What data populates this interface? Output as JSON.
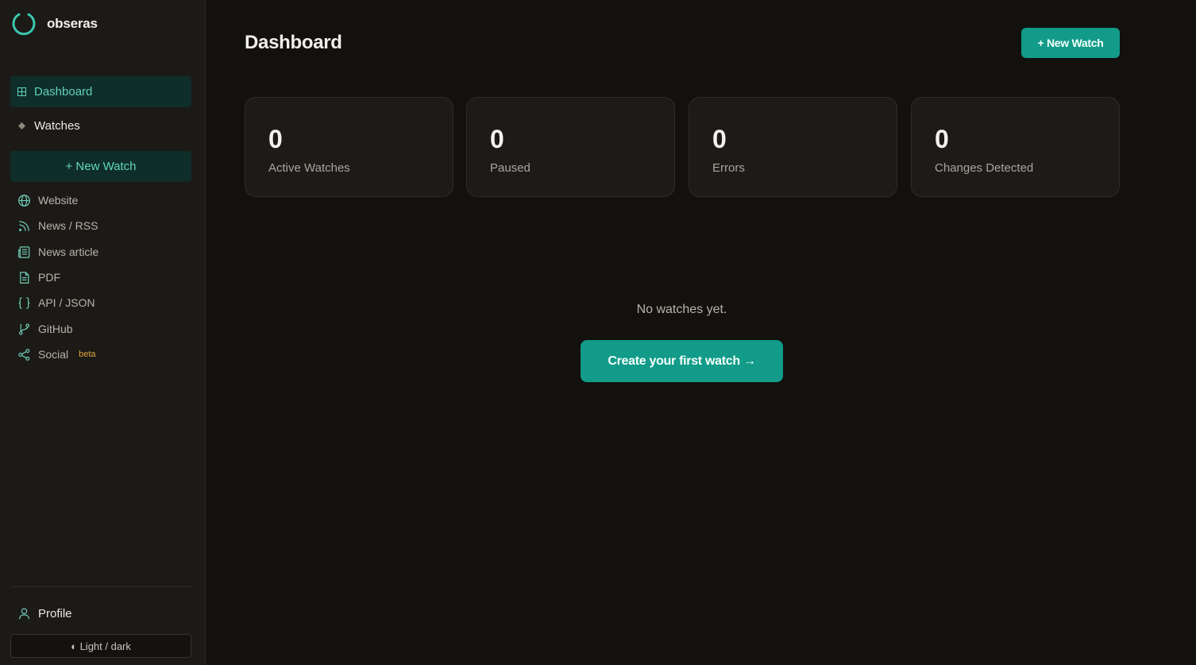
{
  "brand": {
    "name": "obseras",
    "logo_icon": "loading-ring-icon",
    "accent": "#119b88"
  },
  "sidebar": {
    "nav": [
      {
        "label": "Dashboard",
        "icon": "grid-icon",
        "active": true
      },
      {
        "label": "Watches",
        "icon": "diamond-icon",
        "active": false
      }
    ],
    "new_watch_label": "+ New Watch",
    "types": [
      {
        "label": "Website",
        "icon": "globe-icon"
      },
      {
        "label": "News / RSS",
        "icon": "rss-icon"
      },
      {
        "label": "News article",
        "icon": "newspaper-icon"
      },
      {
        "label": "PDF",
        "icon": "document-icon"
      },
      {
        "label": "API / JSON",
        "icon": "braces-icon"
      },
      {
        "label": "GitHub",
        "icon": "git-branch-icon"
      },
      {
        "label": "Social",
        "icon": "share-icon",
        "badge": "beta"
      }
    ],
    "profile_label": "Profile",
    "theme_toggle_label": "◐ Light / dark"
  },
  "main": {
    "title": "Dashboard",
    "new_watch_label": "+ New Watch",
    "stats": [
      {
        "value": "0",
        "label": "Active Watches"
      },
      {
        "value": "0",
        "label": "Paused"
      },
      {
        "value": "0",
        "label": "Errors"
      },
      {
        "value": "0",
        "label": "Changes Detected"
      }
    ],
    "empty_message": "No watches yet.",
    "cta_label": "Create your first watch →"
  }
}
